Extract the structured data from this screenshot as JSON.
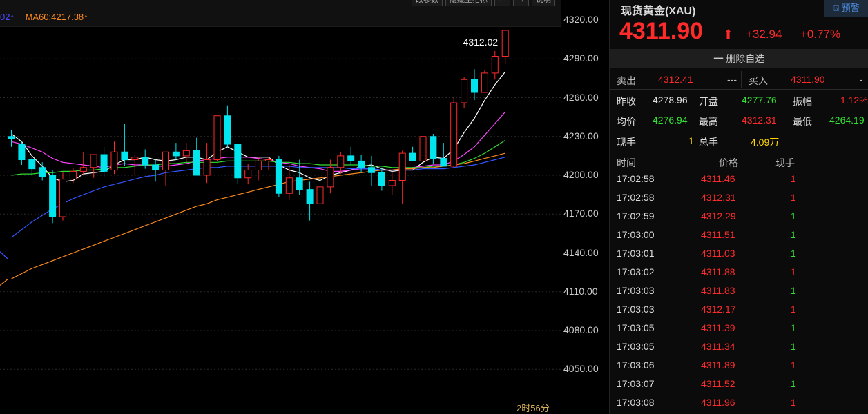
{
  "legend": {
    "ma_prev": "02↑",
    "ma60": "MA60:4217.38↑"
  },
  "toolbar": {
    "btn1": "改参数",
    "btn2": "隐藏主指标",
    "btn3": "←",
    "btn4": "→",
    "btn5": "说明"
  },
  "chart": {
    "last_label": "4312.02",
    "time_label": "2时56分",
    "y_ticks": [
      "4320.00",
      "4290.00",
      "4260.00",
      "4230.00",
      "4200.00",
      "4170.00",
      "4140.00",
      "4110.00",
      "4080.00",
      "4050.00"
    ]
  },
  "chart_data": {
    "type": "candlestick",
    "ylim": [
      4030,
      4330
    ],
    "candles": [
      [
        4230,
        4235,
        4222,
        4228
      ],
      [
        4224,
        4226,
        4208,
        4212
      ],
      [
        4212,
        4214,
        4200,
        4205
      ],
      [
        4206,
        4210,
        4196,
        4199
      ],
      [
        4200,
        4204,
        4163,
        4168
      ],
      [
        4168,
        4202,
        4165,
        4197
      ],
      [
        4197,
        4206,
        4194,
        4203
      ],
      [
        4203,
        4218,
        4200,
        4206
      ],
      [
        4206,
        4214,
        4198,
        4216
      ],
      [
        4216,
        4222,
        4199,
        4203
      ],
      [
        4204,
        4226,
        4201,
        4218
      ],
      [
        4218,
        4240,
        4207,
        4212
      ],
      [
        4212,
        4216,
        4200,
        4214
      ],
      [
        4214,
        4220,
        4205,
        4208
      ],
      [
        4208,
        4212,
        4195,
        4204
      ],
      [
        4204,
        4218,
        4192,
        4218
      ],
      [
        4218,
        4225,
        4212,
        4215
      ],
      [
        4215,
        4225,
        4210,
        4219
      ],
      [
        4219,
        4229,
        4203,
        4200
      ],
      [
        4200,
        4225,
        4194,
        4212
      ],
      [
        4212,
        4246,
        4211,
        4246
      ],
      [
        4246,
        4254,
        4222,
        4224
      ],
      [
        4224,
        4224,
        4193,
        4198
      ],
      [
        4198,
        4209,
        4193,
        4204
      ],
      [
        4204,
        4214,
        4196,
        4211
      ],
      [
        4211,
        4214,
        4204,
        4212
      ],
      [
        4212,
        4215,
        4183,
        4186
      ],
      [
        4186,
        4208,
        4181,
        4198
      ],
      [
        4198,
        4212,
        4185,
        4189
      ],
      [
        4189,
        4195,
        4165,
        4178
      ],
      [
        4178,
        4198,
        4172,
        4191
      ],
      [
        4191,
        4212,
        4186,
        4206
      ],
      [
        4206,
        4218,
        4201,
        4215
      ],
      [
        4215,
        4222,
        4208,
        4211
      ],
      [
        4211,
        4216,
        4202,
        4206
      ],
      [
        4206,
        4215,
        4192,
        4202
      ],
      [
        4202,
        4206,
        4188,
        4192
      ],
      [
        4192,
        4203,
        4185,
        4196
      ],
      [
        4196,
        4219,
        4178,
        4217
      ],
      [
        4217,
        4222,
        4213,
        4211
      ],
      [
        4211,
        4242,
        4208,
        4230
      ],
      [
        4230,
        4232,
        4209,
        4213
      ],
      [
        4213,
        4225,
        4209,
        4207
      ],
      [
        4207,
        4260,
        4206,
        4256
      ],
      [
        4256,
        4276,
        4252,
        4274
      ],
      [
        4274,
        4282,
        4258,
        4264
      ],
      [
        4264,
        4281,
        4264,
        4279
      ],
      [
        4279,
        4296,
        4274,
        4292
      ],
      [
        4292,
        4312,
        4286,
        4312
      ]
    ],
    "ma_lines": [
      {
        "name": "MA5",
        "color": "#ffffff",
        "values": [
          4232,
          4226,
          4215,
          4207,
          4198,
          4195,
          4196,
          4201,
          4202,
          4203,
          4208,
          4212,
          4212,
          4214,
          4212,
          4211,
          4212,
          4214,
          4214,
          4212,
          4218,
          4222,
          4218,
          4214,
          4214,
          4214,
          4208,
          4204,
          4202,
          4198,
          4196,
          4200,
          4202,
          4204,
          4207,
          4208,
          4205,
          4203,
          4204,
          4204,
          4210,
          4214,
          4213,
          4220,
          4233,
          4244,
          4258,
          4270,
          4280
        ]
      },
      {
        "name": "MA10",
        "color": "#ff44ff",
        "values": [
          4226,
          4224,
          4221,
          4218,
          4213,
          4210,
          4209,
          4208,
          4207,
          4206,
          4208,
          4209,
          4208,
          4208,
          4207,
          4207,
          4208,
          4209,
          4211,
          4212,
          4213,
          4214,
          4214,
          4214,
          4213,
          4212,
          4210,
          4209,
          4207,
          4206,
          4205,
          4203,
          4203,
          4204,
          4205,
          4205,
          4204,
          4204,
          4205,
          4206,
          4207,
          4208,
          4208,
          4211,
          4216,
          4222,
          4231,
          4240,
          4249
        ]
      },
      {
        "name": "MA20",
        "color": "#33dd33",
        "values": [
          4200,
          4201,
          4201,
          4202,
          4202,
          4203,
          4203,
          4204,
          4204,
          4205,
          4206,
          4206,
          4207,
          4208,
          4208,
          4209,
          4209,
          4210,
          4210,
          4210,
          4210,
          4211,
          4211,
          4211,
          4211,
          4211,
          4210,
          4210,
          4209,
          4209,
          4208,
          4208,
          4208,
          4208,
          4208,
          4207,
          4207,
          4206,
          4206,
          4206,
          4206,
          4207,
          4207,
          4208,
          4210,
          4213,
          4217,
          4222,
          4227
        ]
      },
      {
        "name": "MA30",
        "color": "#3355ff",
        "values": [
          4152,
          4158,
          4164,
          4169,
          4174,
          4178,
          4182,
          4185,
          4188,
          4191,
          4193,
          4195,
          4197,
          4199,
          4200,
          4202,
          4203,
          4204,
          4205,
          4206,
          4206,
          4207,
          4207,
          4207,
          4207,
          4207,
          4207,
          4207,
          4206,
          4206,
          4206,
          4206,
          4206,
          4205,
          4205,
          4205,
          4204,
          4204,
          4204,
          4204,
          4205,
          4205,
          4205,
          4206,
          4207,
          4208,
          4210,
          4212,
          4214
        ]
      },
      {
        "name": "MA60",
        "color": "#ff8a1e",
        "values": [
          4120,
          4124,
          4128,
          4131,
          4134,
          4137,
          4140,
          4143,
          4146,
          4149,
          4152,
          4155,
          4158,
          4161,
          4164,
          4167,
          4170,
          4173,
          4176,
          4178,
          4181,
          4183,
          4185,
          4187,
          4189,
          4191,
          4193,
          4195,
          4196,
          4197,
          4198,
          4199,
          4200,
          4201,
          4202,
          4203,
          4204,
          4204,
          4205,
          4205,
          4206,
          4206,
          4207,
          4208,
          4209,
          4211,
          4213,
          4215,
          4217
        ]
      }
    ]
  },
  "instrument": {
    "name": "现货黄金(XAU)",
    "alert": "预警",
    "price": "4311.90",
    "change": "+32.94",
    "change_pct": "+0.77%",
    "watch_label": "删除自选"
  },
  "quote": {
    "sell_label": "卖出",
    "sell": "4312.41",
    "sell_vol": "---",
    "buy_label": "买入",
    "buy": "4311.90",
    "buy_vol": "-",
    "prev_close_label": "昨收",
    "prev_close": "4278.96",
    "open_label": "开盘",
    "open": "4277.76",
    "amplitude_label": "振幅",
    "amplitude": "1.12%",
    "avg_label": "均价",
    "avg": "4276.94",
    "high_label": "最高",
    "high": "4312.31",
    "low_label": "最低",
    "low": "4264.19",
    "cur_vol_label": "现手",
    "cur_vol": "1",
    "total_vol_label": "总手",
    "total_vol": "4.09万"
  },
  "ticks_header": {
    "time": "时间",
    "price": "价格",
    "vol": "现手"
  },
  "ticks": [
    {
      "time": "17:02:58",
      "price": "4311.46",
      "vol": "1",
      "dir": "sell"
    },
    {
      "time": "17:02:58",
      "price": "4312.31",
      "vol": "1",
      "dir": "sell"
    },
    {
      "time": "17:02:59",
      "price": "4312.29",
      "vol": "1",
      "dir": "buy"
    },
    {
      "time": "17:03:00",
      "price": "4311.51",
      "vol": "1",
      "dir": "buy"
    },
    {
      "time": "17:03:01",
      "price": "4311.03",
      "vol": "1",
      "dir": "buy"
    },
    {
      "time": "17:03:02",
      "price": "4311.88",
      "vol": "1",
      "dir": "sell"
    },
    {
      "time": "17:03:03",
      "price": "4311.83",
      "vol": "1",
      "dir": "buy"
    },
    {
      "time": "17:03:03",
      "price": "4312.17",
      "vol": "1",
      "dir": "sell"
    },
    {
      "time": "17:03:05",
      "price": "4311.39",
      "vol": "1",
      "dir": "buy"
    },
    {
      "time": "17:03:05",
      "price": "4311.34",
      "vol": "1",
      "dir": "buy"
    },
    {
      "time": "17:03:06",
      "price": "4311.89",
      "vol": "1",
      "dir": "sell"
    },
    {
      "time": "17:03:07",
      "price": "4311.52",
      "vol": "1",
      "dir": "buy"
    },
    {
      "time": "17:03:08",
      "price": "4311.96",
      "vol": "1",
      "dir": "sell"
    }
  ],
  "colors": {
    "up": "#ff2a2a",
    "down": "#00e5ee",
    "buy": "#33e033",
    "sell": "#ff2a2a"
  }
}
